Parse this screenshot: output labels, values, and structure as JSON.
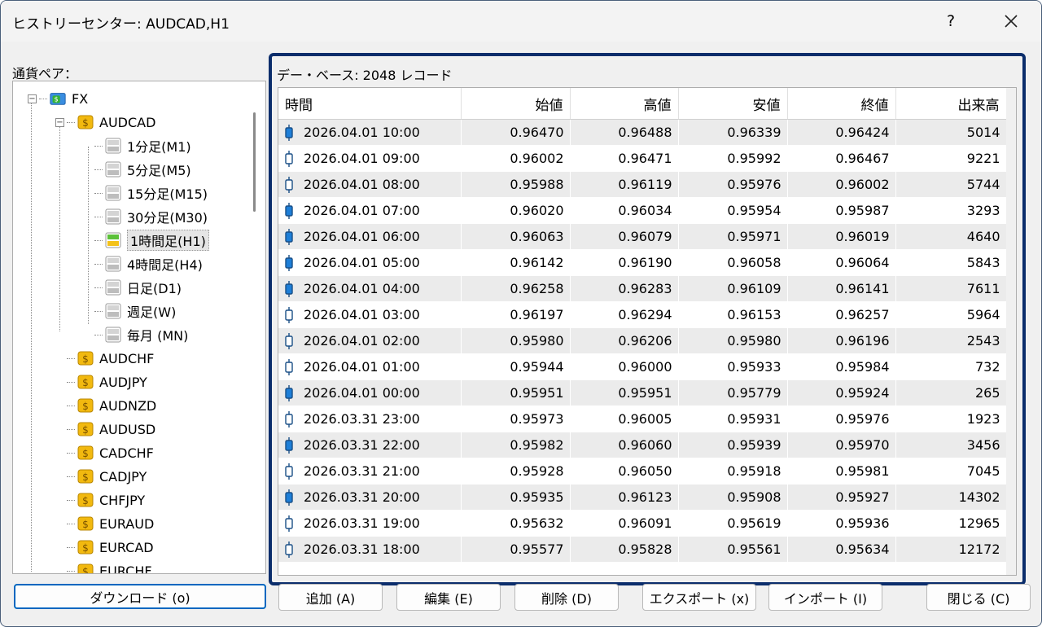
{
  "window": {
    "title": "ヒストリーセンター: AUDCAD,H1",
    "help": "?",
    "close": "✕"
  },
  "tree": {
    "label": "通貨ペア：",
    "root": "FX",
    "expanded": "AUDCAD",
    "timeframes": [
      "1分足(M1)",
      "5分足(M5)",
      "15分足(M15)",
      "30分足(M30)",
      "1時間足(H1)",
      "4時間足(H4)",
      "日足(D1)",
      "週足(W)",
      "毎月 (MN)"
    ],
    "selected_index": 4,
    "pairs": [
      "AUDCHF",
      "AUDJPY",
      "AUDNZD",
      "AUDUSD",
      "CADCHF",
      "CADJPY",
      "CHFJPY",
      "EURAUD",
      "EURCAD",
      "EURCHF"
    ]
  },
  "database": {
    "label": "デー・ベース: 2048 レコード"
  },
  "table": {
    "columns": [
      "時間",
      "始値",
      "高値",
      "安値",
      "終値",
      "出来高"
    ],
    "rows": [
      {
        "time": "2026.04.01 10:00",
        "open": "0.96470",
        "high": "0.96488",
        "low": "0.96339",
        "close": "0.96424",
        "volume": "5014",
        "bear": true
      },
      {
        "time": "2026.04.01 09:00",
        "open": "0.96002",
        "high": "0.96471",
        "low": "0.95992",
        "close": "0.96467",
        "volume": "9221",
        "bear": false
      },
      {
        "time": "2026.04.01 08:00",
        "open": "0.95988",
        "high": "0.96119",
        "low": "0.95976",
        "close": "0.96002",
        "volume": "5744",
        "bear": false
      },
      {
        "time": "2026.04.01 07:00",
        "open": "0.96020",
        "high": "0.96034",
        "low": "0.95954",
        "close": "0.95987",
        "volume": "3293",
        "bear": true
      },
      {
        "time": "2026.04.01 06:00",
        "open": "0.96063",
        "high": "0.96079",
        "low": "0.95971",
        "close": "0.96019",
        "volume": "4640",
        "bear": true
      },
      {
        "time": "2026.04.01 05:00",
        "open": "0.96142",
        "high": "0.96190",
        "low": "0.96058",
        "close": "0.96064",
        "volume": "5843",
        "bear": true
      },
      {
        "time": "2026.04.01 04:00",
        "open": "0.96258",
        "high": "0.96283",
        "low": "0.96109",
        "close": "0.96141",
        "volume": "7611",
        "bear": true
      },
      {
        "time": "2026.04.01 03:00",
        "open": "0.96197",
        "high": "0.96294",
        "low": "0.96153",
        "close": "0.96257",
        "volume": "5964",
        "bear": false
      },
      {
        "time": "2026.04.01 02:00",
        "open": "0.95980",
        "high": "0.96206",
        "low": "0.95980",
        "close": "0.96196",
        "volume": "2543",
        "bear": false
      },
      {
        "time": "2026.04.01 01:00",
        "open": "0.95944",
        "high": "0.96000",
        "low": "0.95933",
        "close": "0.95984",
        "volume": "732",
        "bear": false
      },
      {
        "time": "2026.04.01 00:00",
        "open": "0.95951",
        "high": "0.95951",
        "low": "0.95779",
        "close": "0.95924",
        "volume": "265",
        "bear": true
      },
      {
        "time": "2026.03.31 23:00",
        "open": "0.95973",
        "high": "0.96005",
        "low": "0.95931",
        "close": "0.95976",
        "volume": "1923",
        "bear": false
      },
      {
        "time": "2026.03.31 22:00",
        "open": "0.95982",
        "high": "0.96060",
        "low": "0.95939",
        "close": "0.95970",
        "volume": "3456",
        "bear": true
      },
      {
        "time": "2026.03.31 21:00",
        "open": "0.95928",
        "high": "0.96050",
        "low": "0.95918",
        "close": "0.95981",
        "volume": "7045",
        "bear": false
      },
      {
        "time": "2026.03.31 20:00",
        "open": "0.95935",
        "high": "0.96123",
        "low": "0.95908",
        "close": "0.95927",
        "volume": "14302",
        "bear": true
      },
      {
        "time": "2026.03.31 19:00",
        "open": "0.95632",
        "high": "0.96091",
        "low": "0.95619",
        "close": "0.95936",
        "volume": "12965",
        "bear": false
      },
      {
        "time": "2026.03.31 18:00",
        "open": "0.95577",
        "high": "0.95828",
        "low": "0.95561",
        "close": "0.95634",
        "volume": "12172",
        "bear": false
      }
    ]
  },
  "buttons": {
    "download": "ダウンロード (o)",
    "add": "追加 (A)",
    "edit": "編集 (E)",
    "delete": "削除 (D)",
    "export": "エクスポート (x)",
    "import": "インポート (I)",
    "close": "閉じる (C)"
  },
  "colors": {
    "accent": "#0067c0",
    "panel_border": "#0b2d6b",
    "bear_candle": "#1e7fd8",
    "coin": "#f2b90f"
  }
}
